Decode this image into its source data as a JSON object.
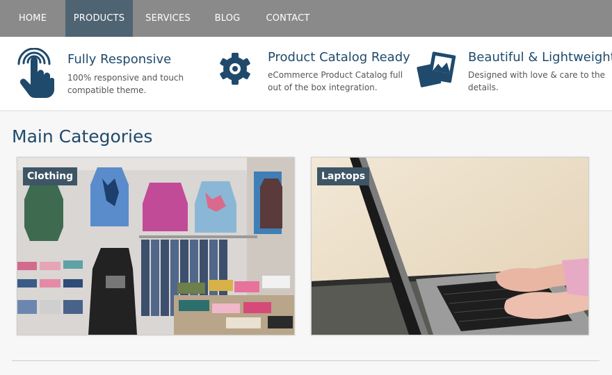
{
  "nav": {
    "items": [
      {
        "label": "HOME"
      },
      {
        "label": "PRODUCTS"
      },
      {
        "label": "SERVICES"
      },
      {
        "label": "BLOG"
      },
      {
        "label": "CONTACT"
      }
    ],
    "active": "PRODUCTS"
  },
  "features": [
    {
      "icon": "touch-hand-icon",
      "title": "Fully Responsive",
      "text": "100% responsive and touch compatible theme."
    },
    {
      "icon": "gear-icon",
      "title": "Product Catalog Ready",
      "text": "eCommerce Product Catalog full out of the box integration."
    },
    {
      "icon": "photos-icon",
      "title": "Beautiful & Lightweight",
      "text": "Designed with love & care to the details."
    }
  ],
  "main": {
    "title": "Main Categories",
    "categories": [
      {
        "label": "Clothing",
        "image": "clothing-store-photo"
      },
      {
        "label": "Laptops",
        "image": "laptop-typing-photo"
      }
    ]
  },
  "colors": {
    "nav_bg": "#8a8a8a",
    "nav_active": "#4f6472",
    "heading": "#1f4a6b",
    "label_bg": "#3e5566"
  }
}
